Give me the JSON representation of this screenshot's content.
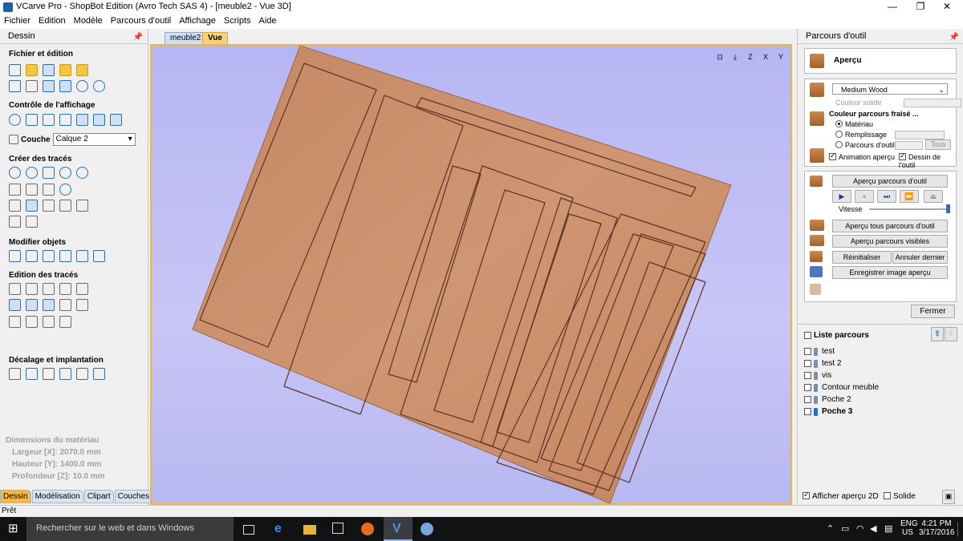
{
  "window": {
    "title": "VCarve Pro - ShopBot Edition (Avro Tech SAS 4) - [meuble2 - Vue 3D]"
  },
  "menu": [
    "Fichier",
    "Edition",
    "Modèle",
    "Parcours d'outil",
    "Affichage",
    "Scripts",
    "Aide"
  ],
  "left_panel": {
    "title": "Dessin",
    "sections": {
      "file": "Fichier et édition",
      "view": "Contrôle de l'affichage",
      "create": "Créer des tracés",
      "modify": "Modifier objets",
      "edit": "Edition des tracés",
      "offset": "Décalage et implantation"
    },
    "layer_label": "Couche",
    "layer_value": "Calque 2",
    "material": {
      "title": "Dimensions du matériau",
      "width": "Largeur   [X]: 2070.0 mm",
      "height": "Hauteur   [Y]: 1400.0 mm",
      "depth": "Profondeur [Z]: 10.0 mm"
    },
    "tabs": [
      "Dessin",
      "Modélisation",
      "Clipart",
      "Couches"
    ]
  },
  "view_tabs": [
    "meuble2",
    "Vue 3D"
  ],
  "view_tools": [
    "⊡",
    "⤓",
    "Z",
    "X",
    "Y"
  ],
  "right_panel": {
    "title": "Parcours d'outil",
    "preview_title": "Aperçu",
    "material_select": "Medium Wood",
    "solid_color_label": "Couleur solide",
    "milled_color_label": "Couleur parcours fraisé ...",
    "radio_material": "Matériau",
    "radio_fill": "Remplissage",
    "radio_toolpath": "Parcours d'outil",
    "all_button": "Tous",
    "anim_preview": "Animation aperçu",
    "tool_drawing": "Dessin de l'outil",
    "preview_toolpath_btn": "Aperçu parcours d'outil",
    "speed_label": "Vitesse",
    "preview_all_btn": "Aperçu tous parcours d'outil",
    "preview_visible_btn": "Aperçu parcours visibles",
    "reset_btn": "Réinitialiser aperçu",
    "cancel_last_btn": "Annuler dernier",
    "save_image_btn": "Enregistrer image aperçu",
    "close_btn": "Fermer",
    "list_title": "Liste parcours",
    "toolpaths": [
      "test",
      "test 2",
      "vis",
      "Contour meuble",
      "Poche 2",
      "Poche 3"
    ],
    "show_2d": "Afficher aperçu 2D",
    "solid": "Solide"
  },
  "status": {
    "text": "Prêt"
  },
  "taskbar": {
    "search": "Rechercher sur le web et dans Windows",
    "lang": "ENG",
    "region": "US",
    "time": "4:21 PM",
    "date": "3/17/2016"
  },
  "colors": {
    "accent": "#f2b53a",
    "wood": "#c98a66",
    "viewport": "#bcbaf4"
  }
}
